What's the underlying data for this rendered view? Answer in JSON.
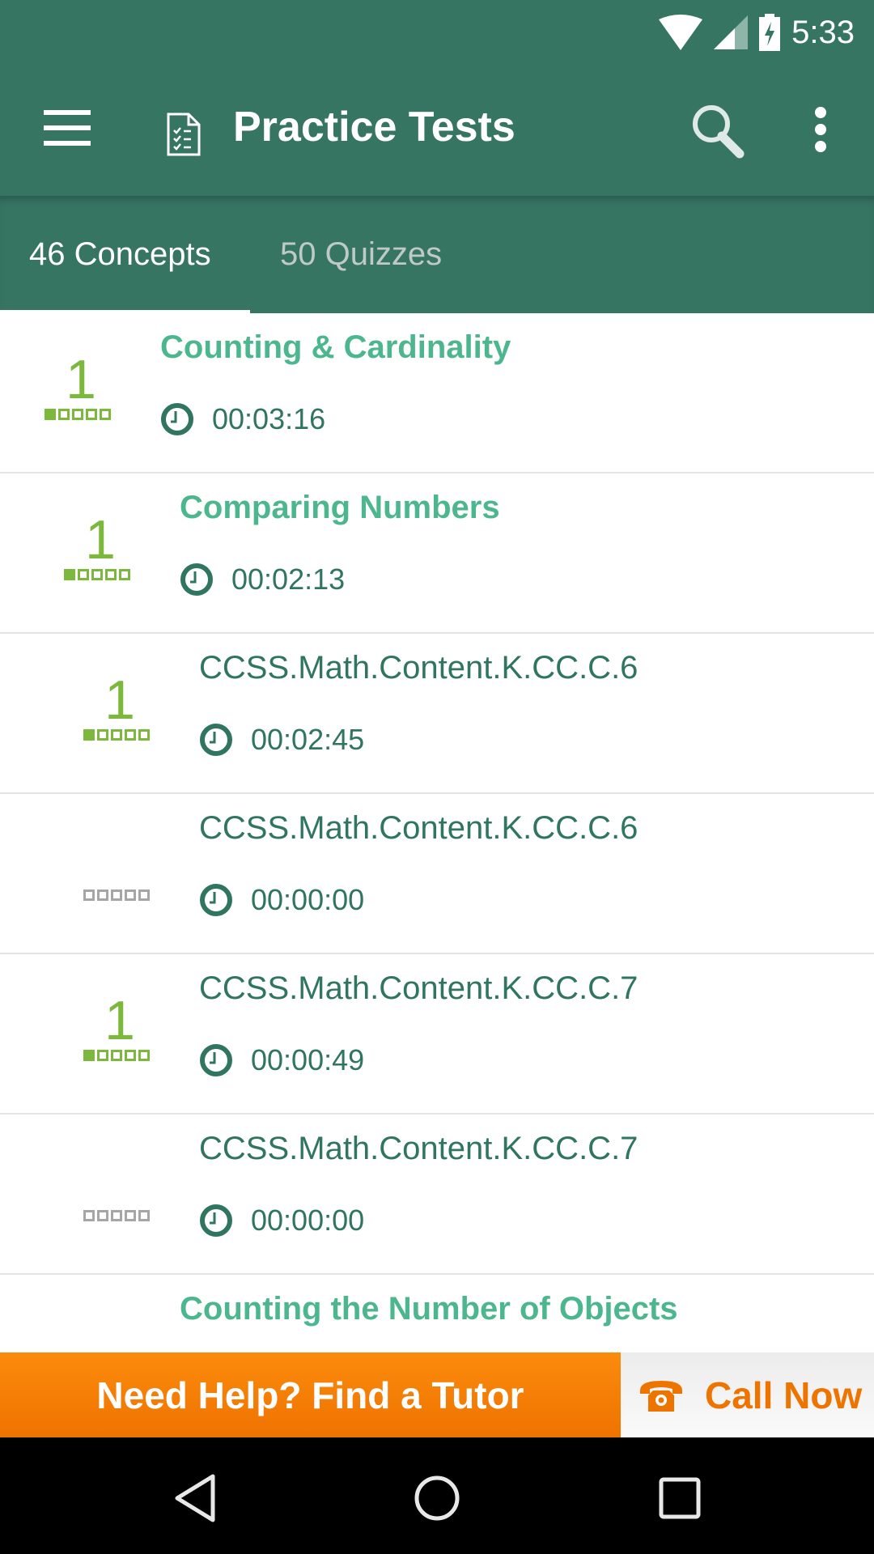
{
  "status_bar": {
    "time": "5:33",
    "icons": [
      "wifi-icon",
      "cell-signal-icon",
      "battery-charging-icon"
    ]
  },
  "app_bar": {
    "title": "Practice Tests",
    "icons": [
      "menu-icon",
      "checklist-document-icon",
      "search-icon",
      "more-vert-icon"
    ]
  },
  "tabs": [
    {
      "label": "46 Concepts",
      "active": true
    },
    {
      "label": "50 Quizzes",
      "active": false
    }
  ],
  "items": [
    {
      "title": "Counting & Cardinality",
      "style": "heading",
      "score": "1",
      "level": 1,
      "max_level": 5,
      "time": "00:03:16"
    },
    {
      "title": "Comparing Numbers",
      "style": "heading",
      "score": "1",
      "level": 1,
      "max_level": 5,
      "time": "00:02:13"
    },
    {
      "title": "CCSS.Math.Content.K.CC.C.6",
      "style": "sub",
      "score": "1",
      "level": 1,
      "max_level": 5,
      "time": "00:02:45"
    },
    {
      "title": "CCSS.Math.Content.K.CC.C.6",
      "style": "sub",
      "score": "",
      "level": 0,
      "max_level": 5,
      "time": "00:00:00"
    },
    {
      "title": "CCSS.Math.Content.K.CC.C.7",
      "style": "sub",
      "score": "1",
      "level": 1,
      "max_level": 5,
      "time": "00:00:49"
    },
    {
      "title": "CCSS.Math.Content.K.CC.C.7",
      "style": "sub",
      "score": "",
      "level": 0,
      "max_level": 5,
      "time": "00:00:00"
    }
  ],
  "partial_item": {
    "title": "Counting the Number of Objects"
  },
  "banner": {
    "help_label": "Need Help? Find a Tutor",
    "call_label": "Call Now"
  },
  "colors": {
    "primary": "#377563",
    "heading_text": "#4cb68f",
    "sub_text": "#2f7560",
    "score_green": "#7cb83c",
    "banner_orange": "#f57f05"
  }
}
